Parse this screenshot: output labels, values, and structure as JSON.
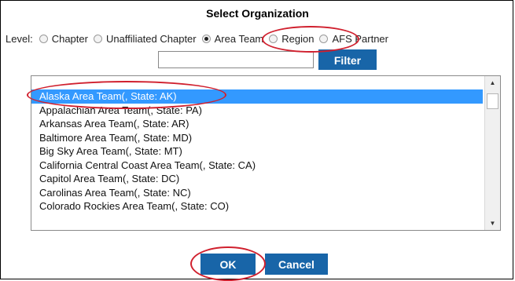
{
  "dialog": {
    "title": "Select Organization",
    "level_label": "Level:",
    "levels": [
      {
        "label": "Chapter",
        "checked": false
      },
      {
        "label": "Unaffiliated Chapter",
        "checked": false
      },
      {
        "label": "Area Team",
        "checked": true
      },
      {
        "label": "Region",
        "checked": false
      },
      {
        "label": "AFS Partner",
        "checked": false
      }
    ],
    "filter": {
      "value": "",
      "button_label": "Filter"
    },
    "list": {
      "selected_index": 0,
      "items": [
        "Alaska Area Team(, State: AK)",
        "Appalachian Area Team(, State: PA)",
        "Arkansas Area Team(, State: AR)",
        "Baltimore Area Team(, State: MD)",
        "Big Sky Area Team(, State: MT)",
        "California Central Coast Area Team(, State: CA)",
        "Capitol Area Team(, State: DC)",
        "Carolinas Area Team(, State: NC)",
        "Colorado Rockies Area Team(, State: CO)"
      ]
    },
    "ok_label": "OK",
    "cancel_label": "Cancel",
    "accent_color": "#1865a8",
    "annotation_color": "#d0202e"
  }
}
